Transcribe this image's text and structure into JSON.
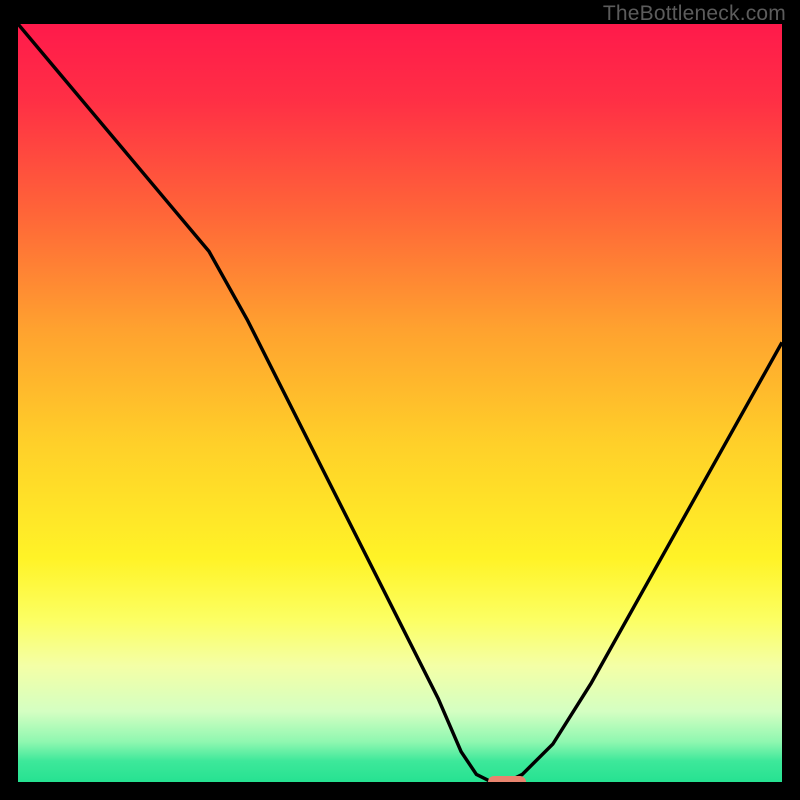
{
  "attribution": "TheBottleneck.com",
  "colors": {
    "frame": "#000000",
    "curve": "#000000",
    "marker": "#e8846e",
    "gradient_stops": [
      {
        "offset": 0.0,
        "color": "#ff1a4b"
      },
      {
        "offset": 0.1,
        "color": "#ff2f45"
      },
      {
        "offset": 0.25,
        "color": "#ff6638"
      },
      {
        "offset": 0.4,
        "color": "#ffa22f"
      },
      {
        "offset": 0.55,
        "color": "#ffd029"
      },
      {
        "offset": 0.7,
        "color": "#fff327"
      },
      {
        "offset": 0.78,
        "color": "#fcff63"
      },
      {
        "offset": 0.84,
        "color": "#f4ffa6"
      },
      {
        "offset": 0.9,
        "color": "#d4ffc2"
      },
      {
        "offset": 0.94,
        "color": "#8ef7b0"
      },
      {
        "offset": 0.965,
        "color": "#3de89a"
      },
      {
        "offset": 1.0,
        "color": "#1fe08f"
      }
    ]
  },
  "chart_data": {
    "type": "line",
    "title": "",
    "xlabel": "",
    "ylabel": "",
    "xlim": [
      0,
      100
    ],
    "ylim": [
      0,
      100
    ],
    "x": [
      0,
      5,
      10,
      15,
      20,
      25,
      30,
      35,
      40,
      45,
      50,
      55,
      58,
      60,
      62,
      64,
      66,
      70,
      75,
      80,
      85,
      90,
      95,
      100
    ],
    "values": [
      100,
      94,
      88,
      82,
      76,
      70,
      61,
      51,
      41,
      31,
      21,
      11,
      4,
      1,
      0,
      0,
      1,
      5,
      13,
      22,
      31,
      40,
      49,
      58
    ],
    "annotations": [
      {
        "type": "inflection_start",
        "x": 25,
        "y": 70
      }
    ],
    "marker": {
      "x_start": 61.5,
      "x_end": 66.5,
      "y": 0
    }
  }
}
